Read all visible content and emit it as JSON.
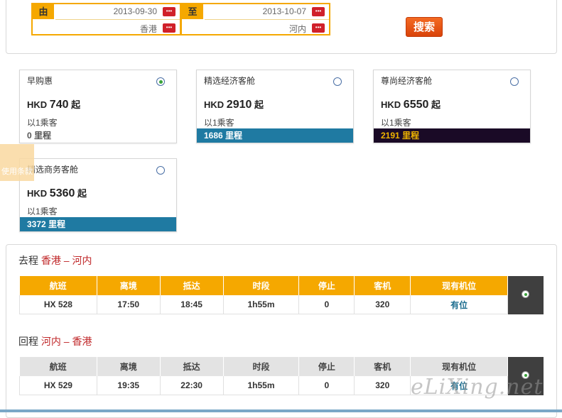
{
  "search": {
    "from_label": "由",
    "to_label": "至",
    "depart_date": "2013-09-30",
    "return_date": "2013-10-07",
    "origin": "香港",
    "destination": "河内",
    "calendar_icon": "calendar-icon",
    "search_button": "搜索"
  },
  "fares": [
    {
      "name": "早购惠",
      "currency": "HKD",
      "amount": "740",
      "suffix": "起",
      "pax": "以1乘客",
      "miles": "0 里程",
      "selected": true
    },
    {
      "name": "精选经济客舱",
      "currency": "HKD",
      "amount": "2910",
      "suffix": "起",
      "pax": "以1乘客",
      "miles": "1686 里程",
      "selected": false
    },
    {
      "name": "尊尚经济客舱",
      "currency": "HKD",
      "amount": "6550",
      "suffix": "起",
      "pax": "以1乘客",
      "miles": "2191 里程",
      "selected": false
    },
    {
      "name": "精选商务客舱",
      "currency": "HKD",
      "amount": "5360",
      "suffix": "起",
      "pax": "以1乘客",
      "miles": "3372 里程",
      "selected": false
    }
  ],
  "side_tab": "使用条款",
  "outbound": {
    "label": "去程",
    "from": "香港",
    "dash": "–",
    "to": "河内",
    "columns": [
      "航班",
      "离境",
      "抵达",
      "时段",
      "停止",
      "客机",
      "现有机位"
    ],
    "row": [
      "HX 528",
      "17:50",
      "18:45",
      "1h55m",
      "0",
      "320",
      "有位"
    ]
  },
  "return": {
    "label": "回程",
    "from": "河内",
    "dash": "–",
    "to": "香港",
    "columns": [
      "航班",
      "离境",
      "抵达",
      "时段",
      "停止",
      "客机",
      "现有机位"
    ],
    "row": [
      "HX 529",
      "19:35",
      "22:30",
      "1h55m",
      "0",
      "320",
      "有位"
    ]
  },
  "watermark": "eLiXing.net",
  "colors": {
    "accent": "#f5a800",
    "button": "#e0501a",
    "city": "#c0282a",
    "blue_bar": "#1f7aa2",
    "dark_bar": "#1a0a26"
  }
}
